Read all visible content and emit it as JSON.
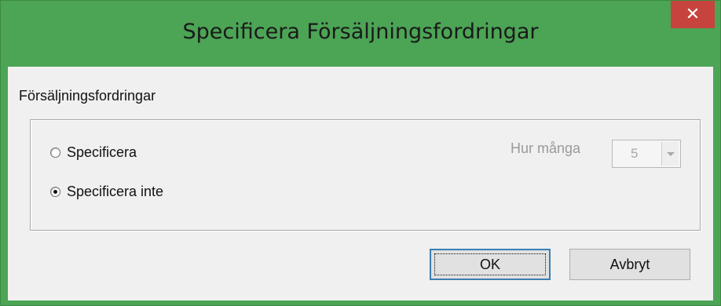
{
  "window": {
    "title": "Specificera Försäljningsfordringar",
    "close_glyph": "✕"
  },
  "section": {
    "label": "Försäljningsfordringar"
  },
  "options": [
    {
      "label": "Specificera",
      "checked": false
    },
    {
      "label": "Specificera inte",
      "checked": true
    }
  ],
  "how_many": {
    "label": "Hur många",
    "value": "5",
    "enabled": false
  },
  "buttons": {
    "ok": "OK",
    "cancel": "Avbryt"
  },
  "colors": {
    "frame": "#4ca455",
    "close": "#c7433d",
    "client": "#f0f0f0",
    "focus": "#3c7fb1"
  }
}
